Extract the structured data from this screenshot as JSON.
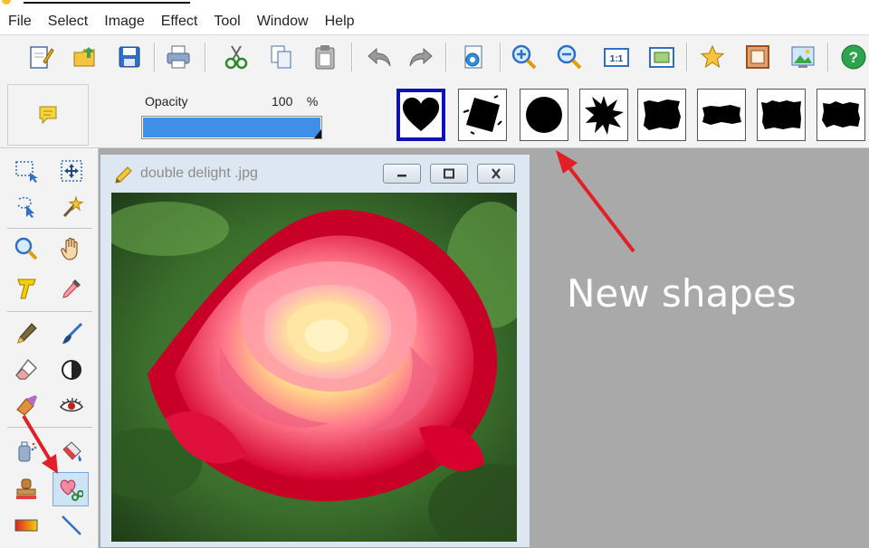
{
  "menu": [
    "File",
    "Select",
    "Image",
    "Effect",
    "Tool",
    "Window",
    "Help"
  ],
  "toolbar_icons": [
    "new-icon",
    "open-icon",
    "save-icon",
    "print-icon",
    "cut-icon",
    "copy-icon",
    "paste-icon",
    "undo-icon",
    "redo-icon",
    "effect-icon",
    "zoom-in-icon",
    "zoom-out-icon",
    "actual-size-icon",
    "fit-window-icon",
    "star-icon",
    "frame-icon",
    "photo-icon",
    "help-icon"
  ],
  "actual_size_label": "1:1",
  "properties": {
    "opacity_label": "Opacity",
    "opacity_value": "100",
    "opacity_unit": "%",
    "opacity_fraction": 1.0
  },
  "shapes": [
    "heart",
    "tilted-square",
    "circle",
    "starburst",
    "rough-rectangle-1",
    "rough-rectangle-2",
    "rough-rectangle-3",
    "rough-rectangle-4"
  ],
  "selected_shape": "heart",
  "document": {
    "title": "double delight .jpg"
  },
  "annotation": {
    "text": "New shapes",
    "color": "#e21f26"
  },
  "colors": {
    "accent": "#3d8fe8",
    "selection": "#1010b8",
    "workspace": "#a9a9a9"
  }
}
